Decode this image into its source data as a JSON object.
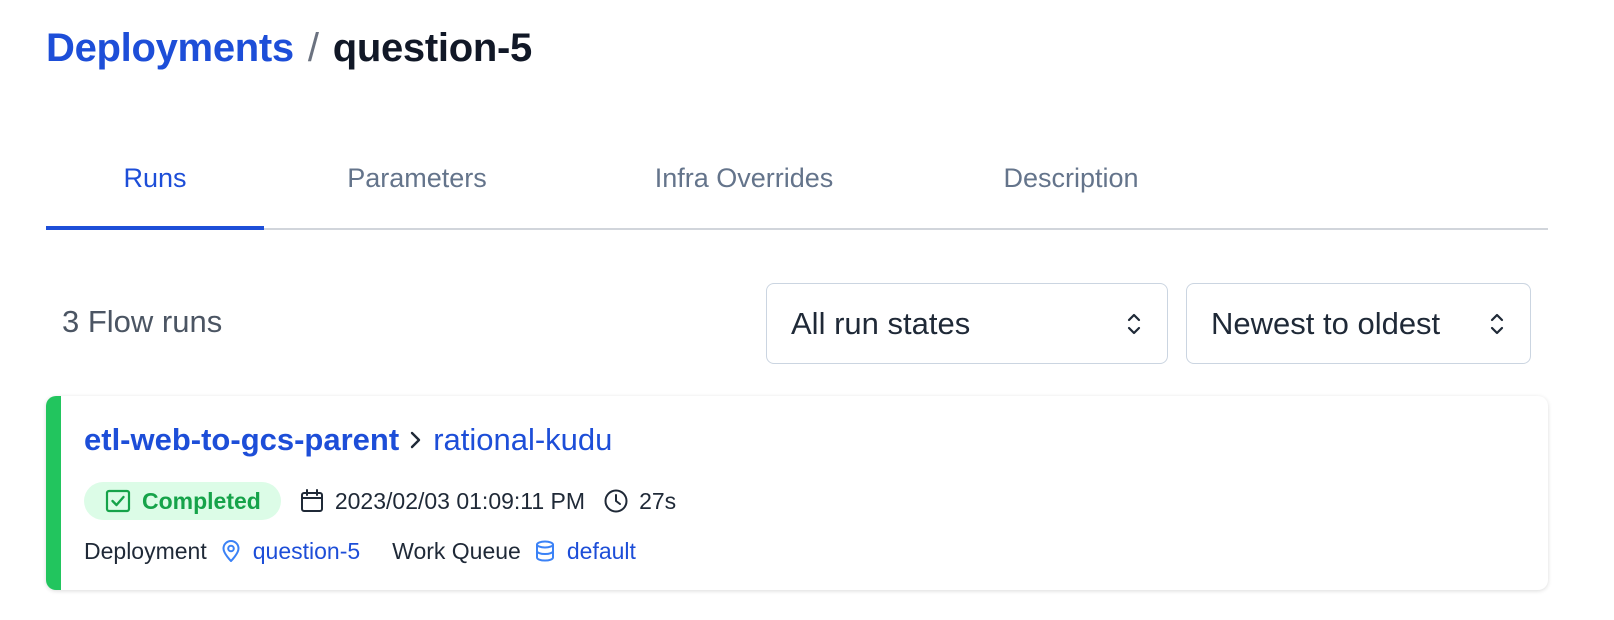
{
  "breadcrumb": {
    "root_label": "Deployments",
    "separator": "/",
    "current_label": "question-5"
  },
  "tabs": [
    {
      "label": "Runs",
      "active": true
    },
    {
      "label": "Parameters",
      "active": false
    },
    {
      "label": "Infra Overrides",
      "active": false
    },
    {
      "label": "Description",
      "active": false
    }
  ],
  "toolbar": {
    "run_count_label": "3 Flow runs",
    "state_filter": {
      "selected": "All run states"
    },
    "sort": {
      "selected": "Newest to oldest"
    }
  },
  "runs": [
    {
      "flow_name": "etl-web-to-gcs-parent",
      "run_name": "rational-kudu",
      "state": "Completed",
      "state_color": "#22c55e",
      "timestamp": "2023/02/03 01:09:11 PM",
      "duration": "27s",
      "deployment_key": "Deployment",
      "deployment_value": "question-5",
      "work_queue_key": "Work Queue",
      "work_queue_value": "default"
    }
  ],
  "colors": {
    "accent": "#1d4ed8",
    "completed_green": "#16a34a",
    "completed_badge_bg": "#dcfce7"
  }
}
